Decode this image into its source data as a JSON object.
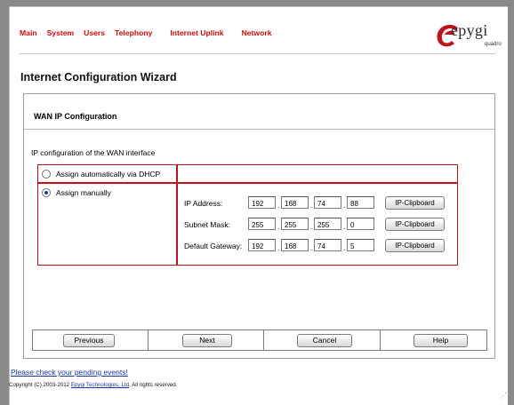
{
  "nav": {
    "items": [
      "Main",
      "System",
      "Users",
      "Telephony",
      "Internet Uplink",
      "Network"
    ]
  },
  "brand": {
    "name": "epygi",
    "subtitle": "quadro",
    "color": "#c0101a"
  },
  "page_title": "Internet Configuration Wizard",
  "panel": {
    "title": "WAN IP Configuration",
    "intro": "IP configuration of the WAN interface"
  },
  "options": {
    "dhcp_label": "Assign automatically via DHCP",
    "manual_label": "Assign manually",
    "selected": "manual"
  },
  "fields": {
    "ip": {
      "label": "IP Address:",
      "octets": [
        "192",
        "168",
        "74",
        "88"
      ]
    },
    "subnet": {
      "label": "Subnet Mask:",
      "octets": [
        "255",
        "255",
        "255",
        "0"
      ]
    },
    "gateway": {
      "label": "Default Gateway:",
      "octets": [
        "192",
        "168",
        "74",
        "5"
      ]
    },
    "clipboard_label": "IP-Clipboard"
  },
  "buttons": {
    "previous": "Previous",
    "next": "Next",
    "cancel": "Cancel",
    "help": "Help"
  },
  "footer": {
    "pending_events": "Please check your pending events!",
    "copyright_prefix": "Copyright (C) 2003-2012 ",
    "copyright_link": "Epygi Technologies, Ltd",
    "copyright_suffix": ". All rights reserved."
  },
  "colors": {
    "nav": "#d10a0a",
    "border_red": "#c0101a",
    "link": "#1a36a8"
  }
}
